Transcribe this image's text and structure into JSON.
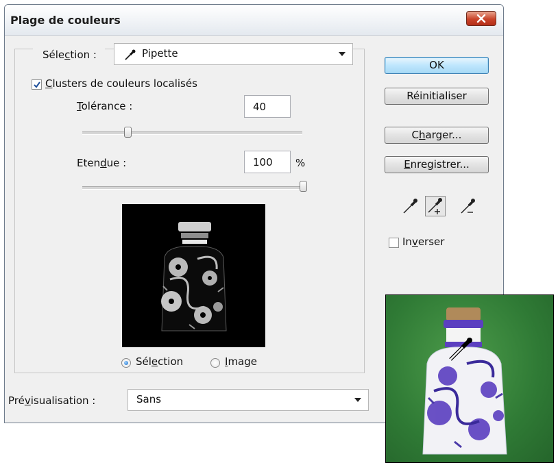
{
  "dialog": {
    "title": "Plage de couleurs"
  },
  "selection": {
    "label_pre": "Séle",
    "label_u": "c",
    "label_post": "tion :",
    "value": "Pipette"
  },
  "clusters": {
    "label_u": "C",
    "label_post": "lusters de couleurs localisés",
    "checked": true
  },
  "tolerance": {
    "label_u": "T",
    "label_post": "olérance :",
    "value": "40",
    "level": 40
  },
  "etendue": {
    "label_pre": "Eten",
    "label_u": "d",
    "label_post": "ue :",
    "value": "100",
    "unit": "%",
    "level": 100
  },
  "view": {
    "selection_pre": "Sél",
    "selection_u": "e",
    "selection_post": "ction",
    "image_u": "I",
    "image_post": "mage",
    "selected": "selection"
  },
  "preview": {
    "label_pre": "Pré",
    "label_u": "v",
    "label_post": "isualisation :",
    "value": "Sans"
  },
  "buttons": {
    "ok": "OK",
    "reset": "Réinitialiser",
    "load_pre": "C",
    "load_u": "h",
    "load_post": "arger...",
    "save_u": "E",
    "save_post": "nregistrer..."
  },
  "invert": {
    "label_pre": "In",
    "label_u": "v",
    "label_post": "erser",
    "checked": false
  },
  "colors": {
    "accent": "#3c7fb1",
    "close": "#c9442a",
    "green_bg": "#2f7a35",
    "blue_pattern": "#5b3fc0"
  }
}
